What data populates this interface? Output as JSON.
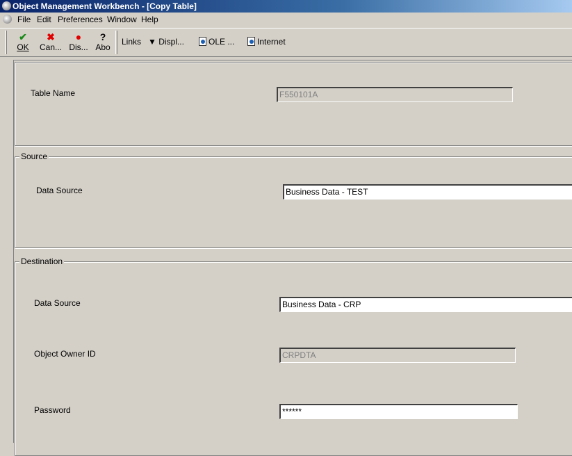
{
  "window": {
    "title": "Object Management Workbench - [Copy Table]"
  },
  "menu": [
    "File",
    "Edit",
    "Preferences",
    "Window",
    "Help"
  ],
  "toolbar": {
    "ok": "OK",
    "cancel": "Can...",
    "display": "Dis...",
    "about": "Abo",
    "links": "Links",
    "displ": "Displ...",
    "ole": "OLE ...",
    "internet": "Internet"
  },
  "table": {
    "label": "Table Name",
    "value": "F550101A"
  },
  "source": {
    "legend": "Source",
    "ds_label": "Data Source",
    "ds_value": "Business Data - TEST"
  },
  "destination": {
    "legend": "Destination",
    "ds_label": "Data Source",
    "ds_value": "Business Data - CRP",
    "owner_label": "Object Owner ID",
    "owner_value": "CRPDTA",
    "pwd_label": "Password",
    "pwd_value": "******"
  }
}
